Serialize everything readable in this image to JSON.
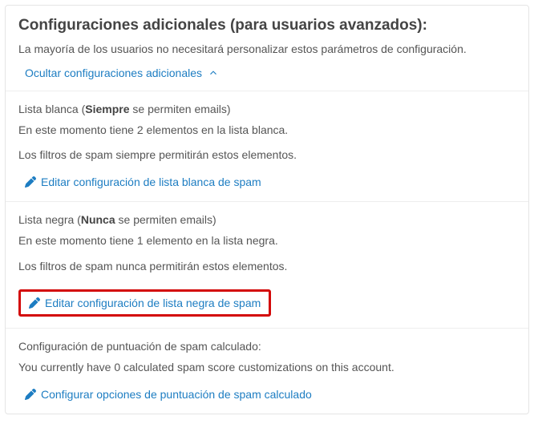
{
  "header": {
    "title": "Configuraciones adicionales (para usuarios avanzados):",
    "subtitle": "La mayoría de los usuarios no necesitará personalizar estos parámetros de configuración.",
    "toggle_label": "Ocultar configuraciones adicionales"
  },
  "whitelist": {
    "heading_pre": "Lista blanca (",
    "heading_bold": "Siempre",
    "heading_post": " se permiten emails)",
    "line1": "En este momento tiene 2 elementos en la lista blanca.",
    "line2": "Los filtros de spam siempre permitirán estos elementos.",
    "edit_label": "Editar configuración de lista blanca de spam"
  },
  "blacklist": {
    "heading_pre": "Lista negra (",
    "heading_bold": "Nunca",
    "heading_post": " se permiten emails)",
    "line1": "En este momento tiene 1 elemento en la lista negra.",
    "line2": "Los filtros de spam nunca permitirán estos elementos.",
    "edit_label": "Editar configuración de lista negra de spam"
  },
  "score": {
    "heading": "Configuración de puntuación de spam calculado:",
    "line1": "You currently have 0 calculated spam score customizations on this account.",
    "edit_label": "Configurar opciones de puntuación de spam calculado"
  }
}
